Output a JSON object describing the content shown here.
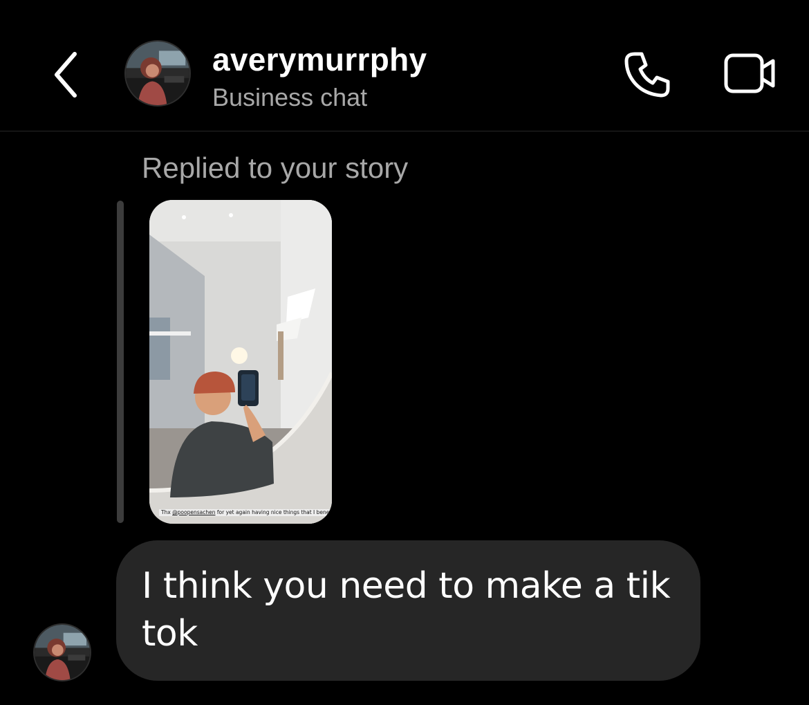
{
  "header": {
    "username": "averymurrphy",
    "subtitle": "Business chat",
    "back_icon": "chevron-left-icon",
    "call_icon": "phone-icon",
    "video_icon": "video-camera-icon"
  },
  "conversation": {
    "reply_label": "Replied to your story",
    "story": {
      "caption_prefix": "Thx ",
      "caption_handle": "@poopensachen",
      "caption_suffix": " for yet again having nice things that I benefit from."
    },
    "message": {
      "text": "I think you need to make a tik tok"
    }
  },
  "colors": {
    "background": "#000000",
    "bubble": "#262626",
    "secondary_text": "#a8a8a8"
  }
}
